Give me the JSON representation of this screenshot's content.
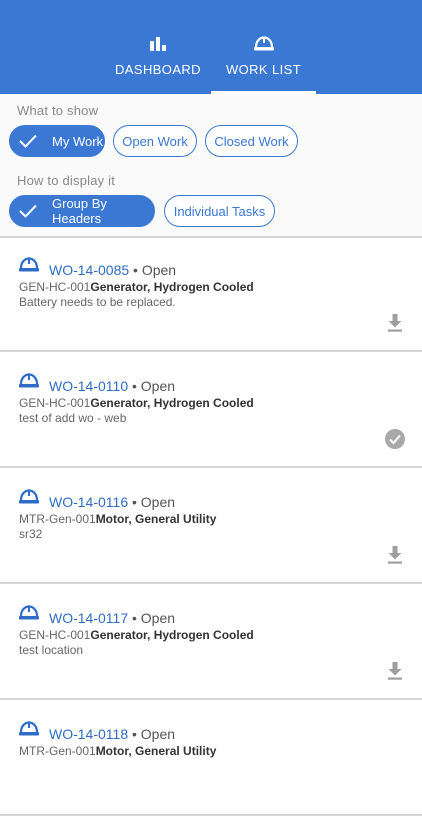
{
  "tabs": [
    {
      "label": "DASHBOARD",
      "icon": "bar-chart-icon",
      "selected": false
    },
    {
      "label": "WORK LIST",
      "icon": "hard-hat-icon",
      "selected": true
    }
  ],
  "filters": {
    "what_to_show_label": "What to show",
    "what_options": [
      {
        "label": "My Work",
        "selected": true
      },
      {
        "label": "Open Work",
        "selected": false
      },
      {
        "label": "Closed Work",
        "selected": false
      }
    ],
    "how_to_display_label": "How to display it",
    "display_options": [
      {
        "label": "Group By Headers",
        "selected": true
      },
      {
        "label": "Individual Tasks",
        "selected": false
      }
    ]
  },
  "work_orders": [
    {
      "id": "WO-14-0085",
      "separator": " • ",
      "status": "Open",
      "asset_code": "GEN-HC-001",
      "asset_name": "Generator, Hydrogen Cooled",
      "description": "Battery needs to be replaced.",
      "action_icon": "download-icon"
    },
    {
      "id": "WO-14-0110",
      "separator": " • ",
      "status": "Open",
      "asset_code": "GEN-HC-001",
      "asset_name": "Generator, Hydrogen Cooled",
      "description": "test of add wo - web",
      "action_icon": "downloaded-check-icon"
    },
    {
      "id": "WO-14-0116",
      "separator": " • ",
      "status": "Open",
      "asset_code": "MTR-Gen-001",
      "asset_name": "Motor, General Utility",
      "description": "sr32",
      "action_icon": "download-icon"
    },
    {
      "id": "WO-14-0117",
      "separator": " • ",
      "status": "Open",
      "asset_code": "GEN-HC-001",
      "asset_name": "Generator, Hydrogen Cooled",
      "description": "test location",
      "action_icon": "download-icon"
    },
    {
      "id": "WO-14-0118",
      "separator": " • ",
      "status": "Open",
      "asset_code": "MTR-Gen-001",
      "asset_name": "Motor, General Utility",
      "description": "",
      "action_icon": "download-icon"
    }
  ],
  "colors": {
    "primary": "#3a78d4",
    "link": "#2f6cc7",
    "icon_gray": "#9e9e9e"
  }
}
